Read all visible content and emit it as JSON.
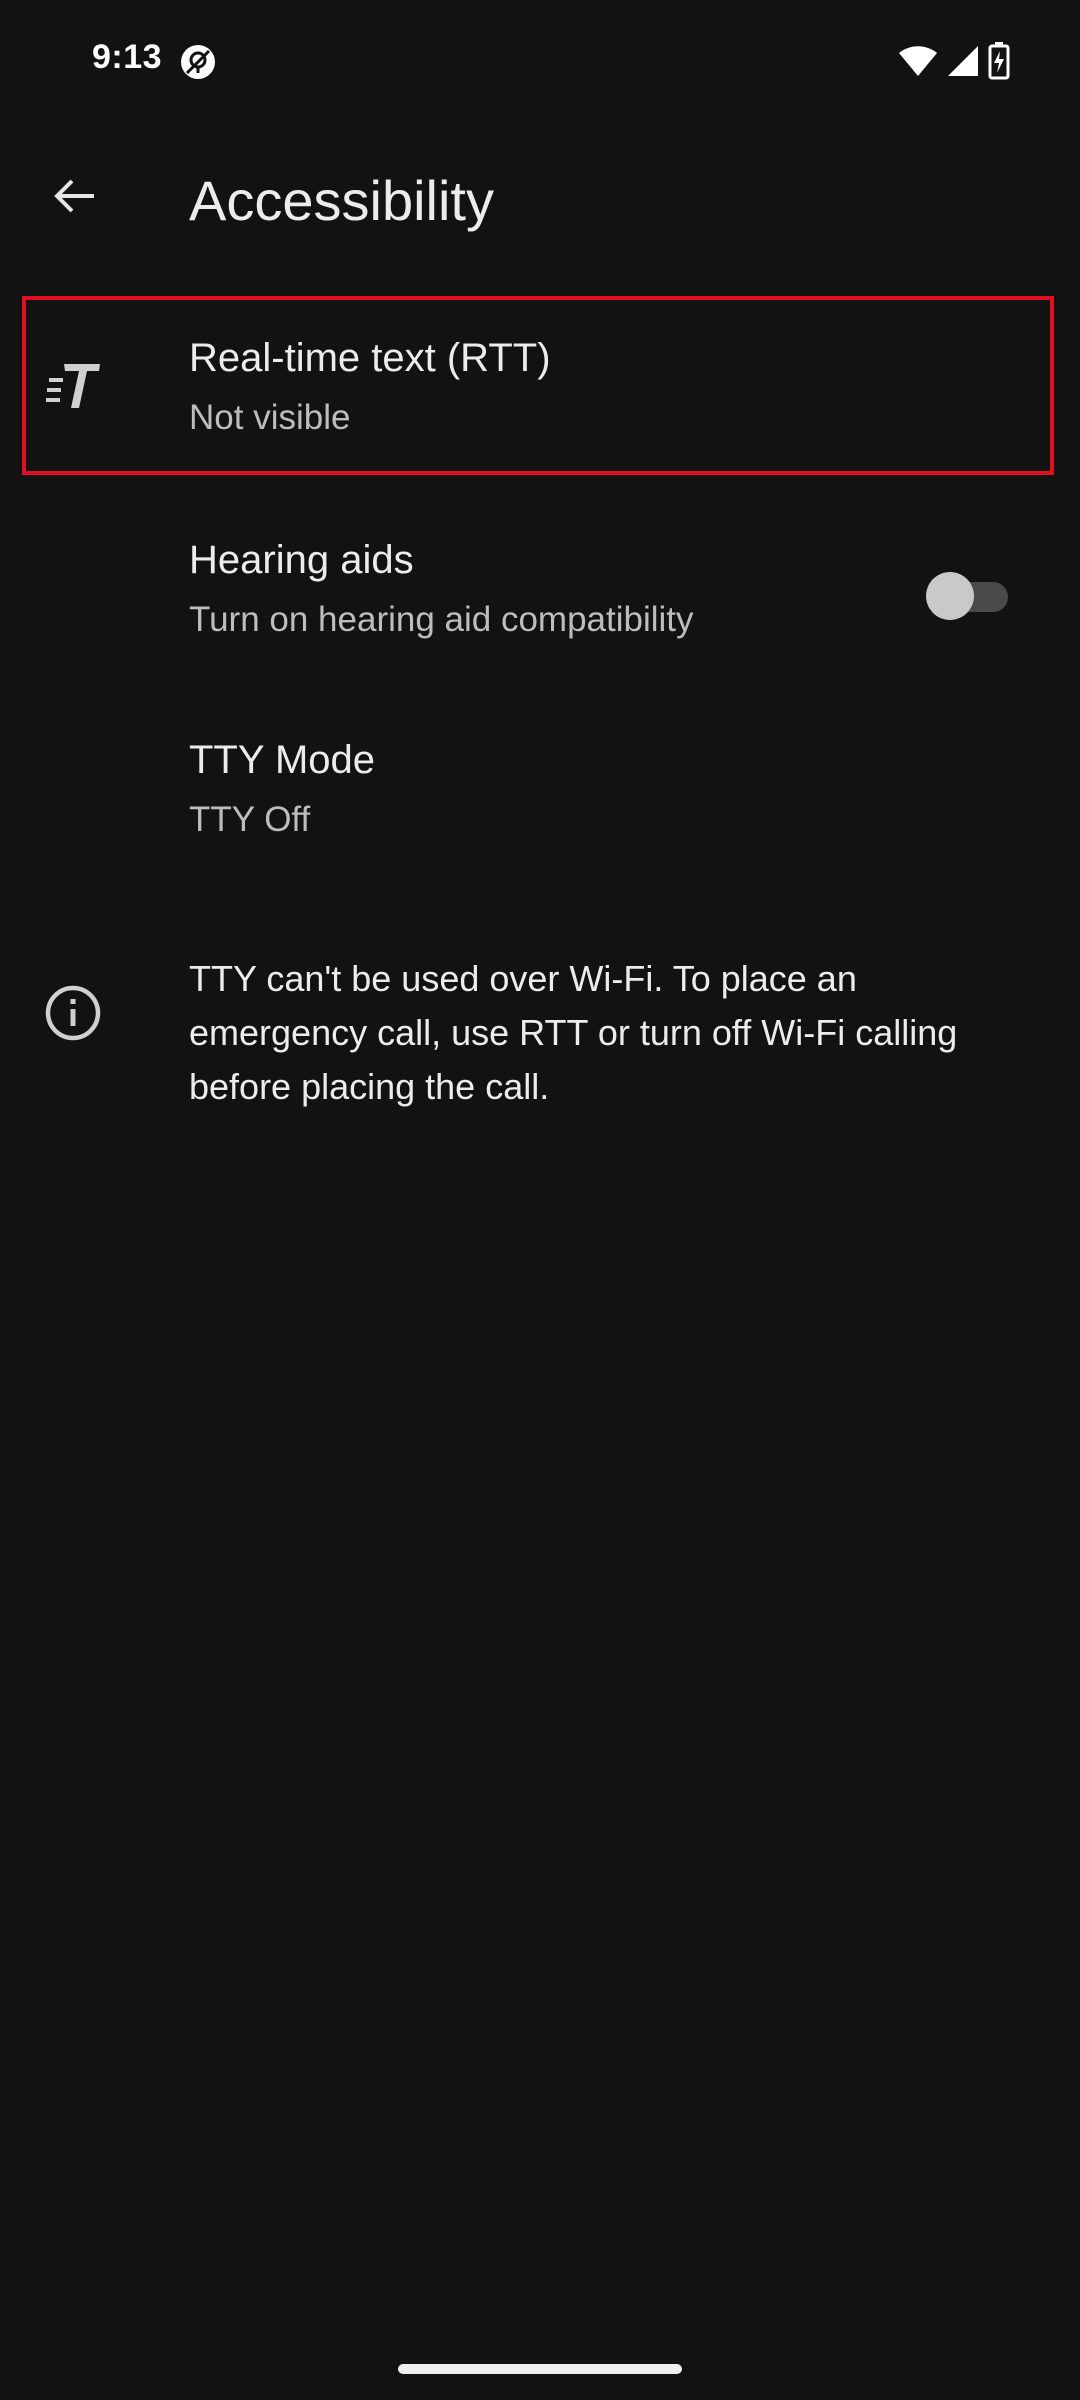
{
  "status_bar": {
    "time": "9:13",
    "left_icon": "no-location-icon",
    "right_icons": [
      "wifi-icon",
      "cell-signal-icon",
      "battery-charging-icon"
    ]
  },
  "app_bar": {
    "back_icon": "arrow-back-icon",
    "title": "Accessibility"
  },
  "items": {
    "rtt": {
      "icon": "rtt-icon",
      "title": "Real-time text (RTT)",
      "subtitle": "Not visible",
      "highlight_color": "#e01020"
    },
    "hearing_aids": {
      "title": "Hearing aids",
      "subtitle": "Turn on hearing aid compatibility",
      "toggle_state": "off"
    },
    "tty_mode": {
      "title": "TTY Mode",
      "subtitle": "TTY Off"
    }
  },
  "info": {
    "icon": "info-icon",
    "text": "TTY can't be used over Wi-Fi. To place an emergency call, use RTT or turn off Wi-Fi calling before placing the call."
  },
  "colors": {
    "background": "#121212",
    "text_primary": "#ececec",
    "text_secondary": "#bdbdbd"
  }
}
